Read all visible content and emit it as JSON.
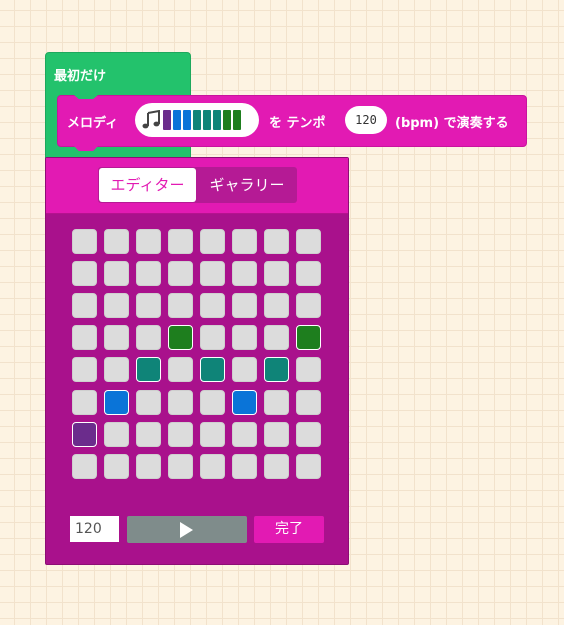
{
  "hat_block": {
    "label": "最初だけ",
    "color": "#23c26c"
  },
  "melody_block": {
    "prefix": "メロディ",
    "mid": "を テンポ",
    "tempo": "120",
    "suffix": "(bpm) で演奏する",
    "color": "#e21ab3",
    "preview_icon": "music-note-icon",
    "preview_colors": [
      "#6b2c8c",
      "#0a74d8",
      "#0a74d8",
      "#0f8478",
      "#0f8478",
      "#0f8478",
      "#1e7e1e",
      "#1e7e1e"
    ]
  },
  "editor": {
    "tabs": [
      {
        "label": "エディター",
        "active": true
      },
      {
        "label": "ギャラリー",
        "active": false
      }
    ],
    "grid": {
      "rows": 8,
      "cols": 8,
      "empty_color": "#dcdcdc",
      "notes": [
        {
          "col": 0,
          "row": 6,
          "color": "#6b2c8c"
        },
        {
          "col": 1,
          "row": 5,
          "color": "#0a74d8"
        },
        {
          "col": 2,
          "row": 4,
          "color": "#0f8478"
        },
        {
          "col": 3,
          "row": 3,
          "color": "#1e7e1e"
        },
        {
          "col": 4,
          "row": 4,
          "color": "#0f8478"
        },
        {
          "col": 5,
          "row": 5,
          "color": "#0a74d8"
        },
        {
          "col": 6,
          "row": 4,
          "color": "#0f8478"
        },
        {
          "col": 7,
          "row": 3,
          "color": "#1e7e1e"
        }
      ]
    },
    "tempo_value": "120",
    "play_icon": "play-icon",
    "done_label": "完了"
  }
}
